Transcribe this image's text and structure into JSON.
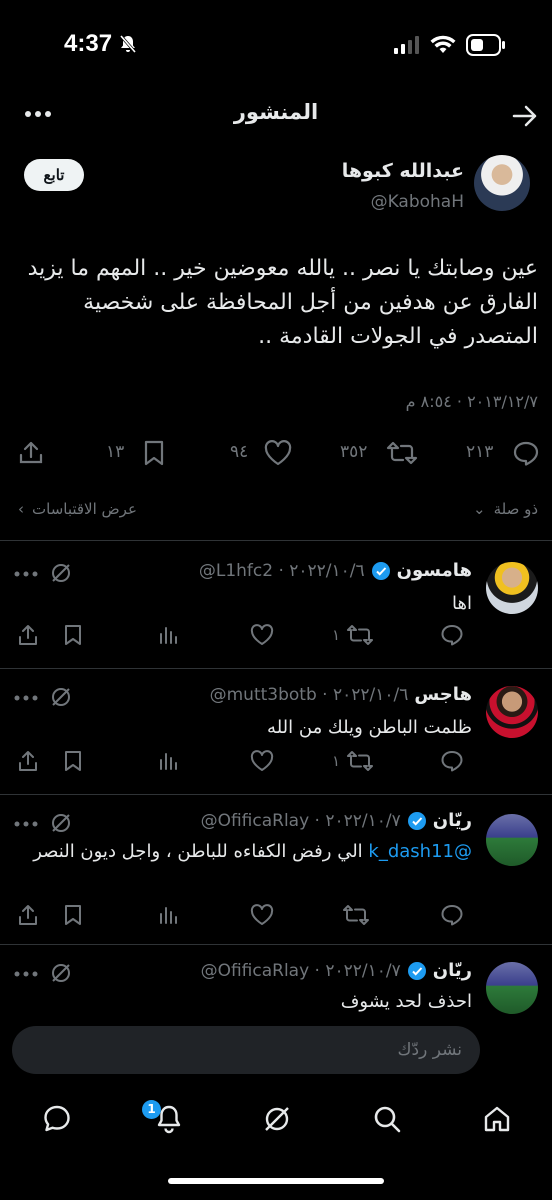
{
  "status_bar": {
    "time": "4:37"
  },
  "header": {
    "title": "المنشور"
  },
  "post": {
    "author_name": "عبدالله كبوها",
    "author_handle": "@KabohaH",
    "follow_label": "تابع",
    "text": "عين وصابتك يا نصر .. يالله معوضين خير .. المهم ما يزيد الفارق عن هدفين من أجل المحافظة على شخصية المتصدر في الجولات القادمة ..",
    "timestamp": "٢٠١٣/١٢/٧ · ٨:٥٤ م",
    "stats": {
      "replies": "٢١٣",
      "retweets": "٣٥٢",
      "likes": "٩٤",
      "bookmarks": "١٣"
    }
  },
  "filters": {
    "sort_label": "ذو صلة",
    "quotes_label": "عرض الاقتباسات"
  },
  "replies": [
    {
      "name": "هامسون",
      "handle_date": "@L1hfc2 · ٢٠٢٢/١٠/٦",
      "text": "اها",
      "retweets": "١",
      "verified": true
    },
    {
      "name": "هاجس",
      "handle_date": "@mutt3botb · ٢٠٢٢/١٠/٦",
      "text": "ظلمت الباطن ويلك من الله",
      "retweets": "١",
      "verified": false
    },
    {
      "name": "ريّان",
      "handle_date": "@OfificaRlay · ٢٠٢٢/١٠/٧",
      "mention": "@k_dash11",
      "text": "الي رفض الكفاءه للباطن ، واجل ديون النصر",
      "retweets": "",
      "verified": true
    },
    {
      "name": "ريّان",
      "handle_date": "@OfificaRlay · ٢٠٢٢/١٠/٧",
      "text": "احذف لحد يشوف",
      "retweets": "",
      "verified": true
    }
  ],
  "compose": {
    "placeholder": "نشر ردّك"
  },
  "tabbar": {
    "notifications_badge": "1"
  },
  "colors": {
    "accent": "#1d9bf0",
    "background": "#000000",
    "muted": "#71767b"
  }
}
